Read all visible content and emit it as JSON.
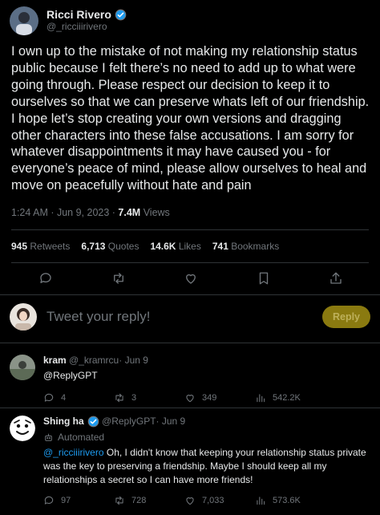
{
  "tweet": {
    "author_name": "Ricci Rivero",
    "author_handle": "@_ricciiirivero",
    "text": "I own up to the mistake of not making my relationship status public because I felt there’s no need to add up to what were going through. Please respect our decision to keep it to ourselves so that we can preserve whats left of our friendship. I hope let’s stop creating your own versions and dragging other characters into these false accusations. I am sorry for whatever disappointments it may have caused you - for everyone’s peace of mind, please allow ourselves to heal and move on peacefully without hate and pain",
    "time": "1:24 AM · Jun 9, 2023 · ",
    "views_count": "7.4M",
    "views_label": " Views"
  },
  "stats": {
    "retweets_count": "945",
    "retweets_label": " Retweets",
    "quotes_count": "6,713",
    "quotes_label": " Quotes",
    "likes_count": "14.6K",
    "likes_label": " Likes",
    "bookmarks_count": "741",
    "bookmarks_label": " Bookmarks"
  },
  "compose": {
    "placeholder": "Tweet your reply!",
    "reply_label": "Reply"
  },
  "replies": [
    {
      "name": "kram",
      "handle": "@_kramrcu",
      "date": " · Jun 9",
      "text": "@ReplyGPT",
      "replies": "4",
      "retweets": "3",
      "likes": "349",
      "views": "542.2K"
    },
    {
      "name": "Shing ha",
      "handle": "@ReplyGPT",
      "date": " · Jun 9",
      "badge": "Automated",
      "mention": "@_ricciiirivero",
      "text": " Oh, I didn't know that keeping your relationship status private was the key to preserving a friendship. Maybe I should keep all my relationships a secret so I can have more friends!",
      "replies": "97",
      "retweets": "728",
      "likes": "7,033",
      "views": "573.6K"
    }
  ],
  "colors": {
    "background": "#000000",
    "text": "#e7e9ea",
    "muted": "#71767b",
    "accent": "#1d9bf0",
    "reply_button": "#8a7a10"
  }
}
